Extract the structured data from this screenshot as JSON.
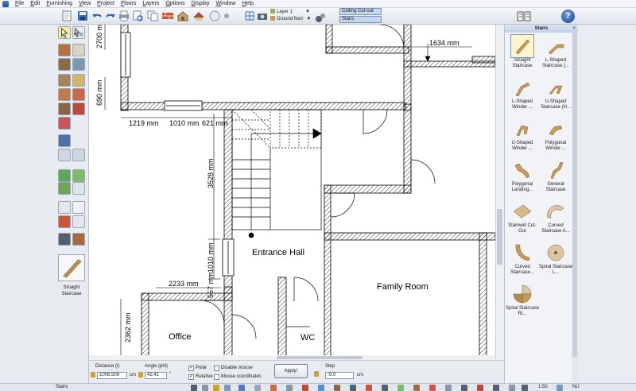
{
  "menu": [
    "File",
    "Edit",
    "Furnishing",
    "View",
    "Project",
    "Floors",
    "Layers",
    "Options",
    "Display",
    "Window",
    "Help"
  ],
  "toolbar": {
    "layer": "Layer 1",
    "floor": "Ground floor",
    "mode_top": "Ceiling Cut-out",
    "mode_bottom": "Stairs",
    "help_glyph": "?"
  },
  "left_panel": {
    "preview_label": "Straight Staircase"
  },
  "plan": {
    "rooms": [
      "Entrance Hall",
      "Family Room",
      "Office",
      "WC"
    ],
    "dimensions": {
      "d1634": "1634 mm",
      "d2700": "2700 mm",
      "d690": "690 mm",
      "d1219": "1219 mm",
      "d1010h": "1010 mm",
      "d621": "621 mm",
      "d3528": "3528 mm",
      "d1010v": "1010 mm",
      "d2233": "2233 mm",
      "d557": "557 mm",
      "d2362": "2362 mm"
    }
  },
  "right_panel": {
    "title": "Stairs",
    "close": "×",
    "items": [
      "Straight Staircase",
      "L-Shaped Staircase (...",
      "L-Shaped Winder ...",
      "U-Shaped Staircase (H...",
      "U-Shaped Winder ...",
      "Polygonal Winder ...",
      "Polygonal Landing...",
      "General Staircase",
      "Stairwell Cut-Out",
      "Curved Staircase A...",
      "Curved Staircase...",
      "Spiral Staircase L...",
      "Spiral Staircase Ri..."
    ]
  },
  "input_bar": {
    "distance_label": "Distance (l)",
    "distance_value": "1008.509",
    "distance_unit": "cm",
    "angle_label": "Angle (phi)",
    "angle_value": "42.41",
    "angle_unit": "°",
    "polar": "Polar",
    "relative": "Relative",
    "disable_mouse": "Disable mouse",
    "mouse_coords": "Mouse coordinates",
    "apply": "Apply!",
    "step_label": "Step",
    "step_value": "-5.0",
    "step_unit": "cm"
  },
  "status": {
    "left": "Stairs",
    "scale": "1:50",
    "right": "NU"
  },
  "colors": {
    "accent": "#c3d0e5",
    "wall": "#000000",
    "stair_thumb": "#c89a5a"
  }
}
